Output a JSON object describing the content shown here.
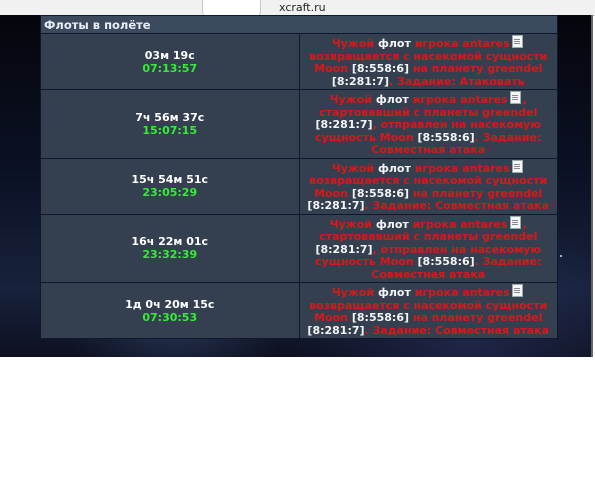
{
  "browser": {
    "url": "xcraft.ru"
  },
  "fleets": {
    "title": "Флоты в полёте",
    "rows": [
      {
        "duration": "03м 19с",
        "clock": "07:13:57",
        "alien": "Чужой",
        "fleet": "флот",
        "player": "игрока antares",
        "text1": "возвращается с насекомой сущности",
        "entity": "Moon",
        "coord1": "[8:558:6]",
        "text2": "на планету greendel",
        "coord2": "[8:281:7]",
        "mission": ". Задание: Атаковать"
      },
      {
        "duration": "7ч 56м 37с",
        "clock": "15:07:15",
        "alien": "Чужой",
        "fleet": "флот",
        "player": "игрока antares",
        "text1": ", стартовавший с планеты greendel",
        "coord1": "[8:281:7]",
        "text2": ", отправлен на насекомую сущность Moon",
        "coord2": "[8:558:6]",
        "mission": ". Задание: Совместная атака"
      },
      {
        "duration": "15ч 54м 51с",
        "clock": "23:05:29",
        "alien": "Чужой",
        "fleet": "флот",
        "player": "игрока antares",
        "text1": "возвращается с насекомой сущности",
        "entity": "Moon",
        "coord1": "[8:558:6]",
        "text2": "на планету greendel",
        "coord2": "[8:281:7]",
        "mission": ". Задание: Совместная атака"
      },
      {
        "duration": "16ч 22м 01с",
        "clock": "23:32:39",
        "alien": "Чужой",
        "fleet": "флот",
        "player": "игрока antares",
        "text1": ", стартовавший с планеты greendel",
        "coord1": "[8:281:7]",
        "text2": ", отправлен на насекомую сущность Moon",
        "coord2": "[8:558:6]",
        "mission": ". Задание: Совместная атака"
      },
      {
        "duration": "1д 0ч 20м 15с",
        "clock": "07:30:53",
        "alien": "Чужой",
        "fleet": "флот",
        "player": "игрока antares",
        "text1": "возвращается с насекомой сущности",
        "entity": "Moon",
        "coord1": "[8:558:6]",
        "text2": "на планету greendel",
        "coord2": "[8:281:7]",
        "mission": ". Задание: Совместная атака"
      }
    ]
  }
}
